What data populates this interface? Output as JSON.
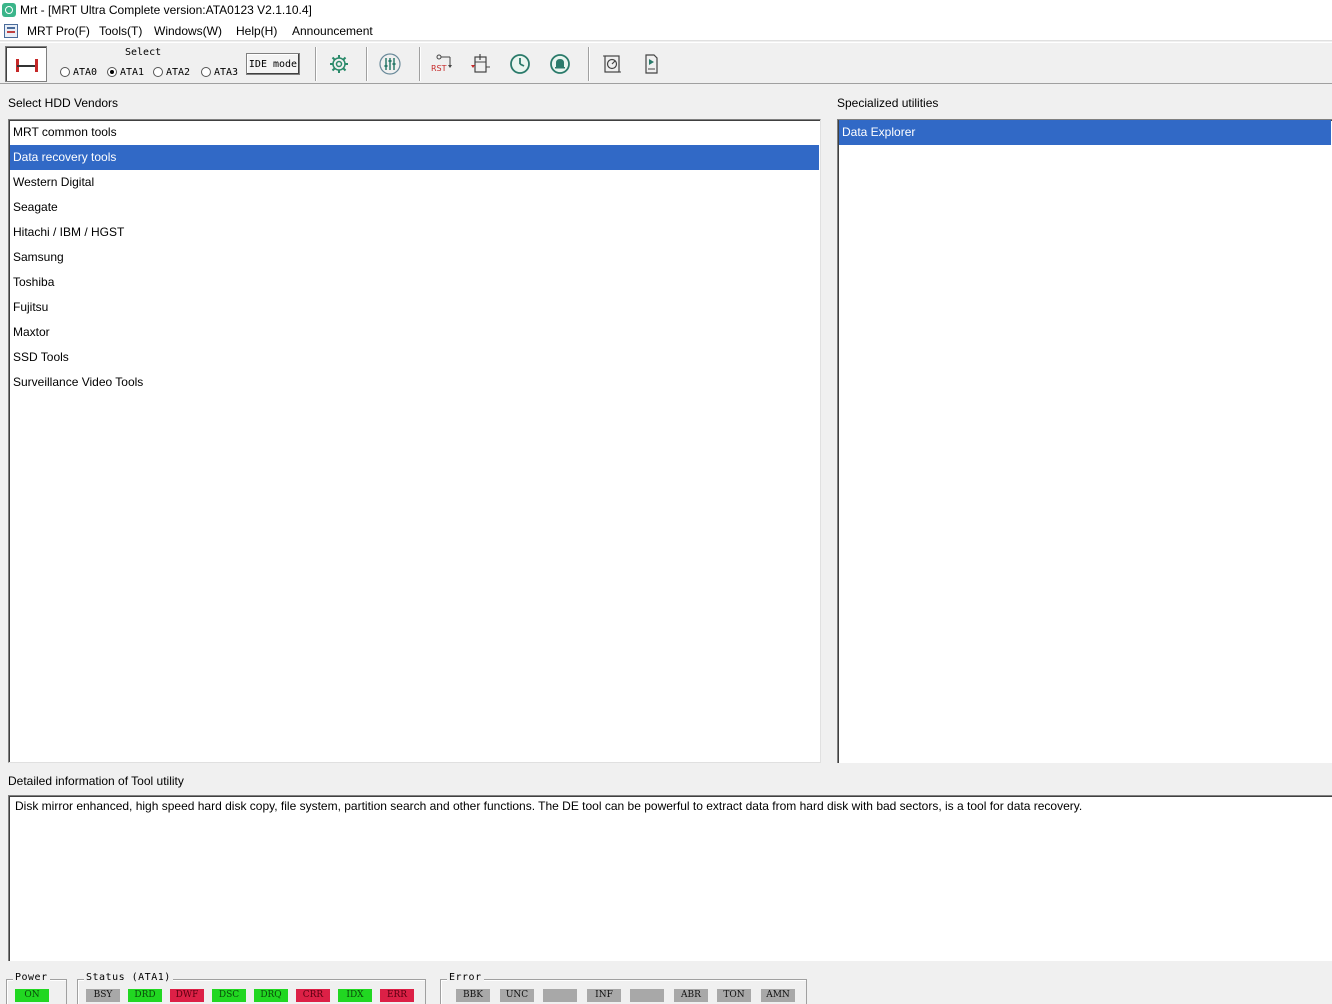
{
  "window": {
    "title": "Mrt - [MRT Ultra Complete version:ATA0123 V2.1.10.4]"
  },
  "menu": {
    "items": [
      "MRT Pro(F)",
      "Tools(T)",
      "Windows(W)",
      "Help(H)",
      "Announcement"
    ]
  },
  "toolbar": {
    "select_label": "Select",
    "radios": [
      {
        "label": "ATA0",
        "checked": false
      },
      {
        "label": "ATA1",
        "checked": true
      },
      {
        "label": "ATA2",
        "checked": false
      },
      {
        "label": "ATA3",
        "checked": false
      }
    ],
    "ide_mode_label": "IDE mode",
    "icons": [
      "disconnect-icon",
      "settings-gear-icon",
      "equalizer-icon",
      "reset-icon",
      "power-cycle-icon",
      "clock-icon",
      "bell-icon",
      "disk-scan-icon",
      "play-device-icon"
    ],
    "rst_label": "RST"
  },
  "vendors": {
    "heading": "Select HDD Vendors",
    "items": [
      "MRT common tools",
      "Data recovery tools",
      "Western Digital",
      "Seagate",
      "Hitachi / IBM / HGST",
      "Samsung",
      "Toshiba",
      "Fujitsu",
      "Maxtor",
      "SSD Tools",
      "Surveillance Video Tools"
    ],
    "selected_index": 1
  },
  "utilities": {
    "heading": "Specialized utilities",
    "items": [
      "Data Explorer"
    ],
    "selected_index": 0
  },
  "detail": {
    "heading": "Detailed information of Tool utility",
    "text": "Disk mirror enhanced, high speed hard disk copy, file system, partition search and other functions. The DE tool can be powerful to extract data from hard disk with bad sectors, is a tool for data recovery."
  },
  "status_bar": {
    "power": {
      "label": "Power",
      "leds": [
        {
          "text": "ON",
          "color": "green"
        }
      ]
    },
    "status": {
      "label": "Status (ATA1)",
      "leds": [
        {
          "text": "BSY",
          "color": "gray"
        },
        {
          "text": "DRD",
          "color": "green"
        },
        {
          "text": "DWF",
          "color": "red"
        },
        {
          "text": "DSC",
          "color": "green"
        },
        {
          "text": "DRQ",
          "color": "green"
        },
        {
          "text": "CRR",
          "color": "red"
        },
        {
          "text": "IDX",
          "color": "green"
        },
        {
          "text": "ERR",
          "color": "red"
        }
      ]
    },
    "error": {
      "label": "Error",
      "leds": [
        {
          "text": "BBK",
          "color": "gray"
        },
        {
          "text": "UNC",
          "color": "gray"
        },
        {
          "text": "",
          "color": "gray"
        },
        {
          "text": "INF",
          "color": "gray"
        },
        {
          "text": "",
          "color": "gray"
        },
        {
          "text": "ABR",
          "color": "gray"
        },
        {
          "text": "TON",
          "color": "gray"
        },
        {
          "text": "AMN",
          "color": "gray"
        }
      ]
    }
  },
  "colors": {
    "selection": "#3169c6",
    "led_green": "#21d721",
    "led_red": "#dc2046",
    "led_gray": "#a8a8a8"
  }
}
